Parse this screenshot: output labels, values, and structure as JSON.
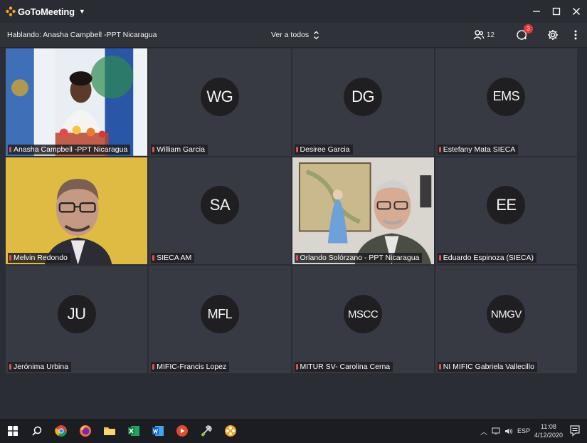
{
  "app": {
    "logo_text": "GoToMeeting"
  },
  "toolbar": {
    "speaking_text": "Hablando: Anasha Campbell -PPT Nicaragua",
    "view_label": "Ver a todos",
    "attendee_count": "12",
    "chat_badge": "3"
  },
  "tiles": [
    {
      "name": "Anasha Campbell -PPT Nicaragua",
      "initials": ""
    },
    {
      "name": "William Garcia",
      "initials": "WG"
    },
    {
      "name": "Desiree Garcia",
      "initials": "DG"
    },
    {
      "name": "Estefany Mata SIECA",
      "initials": "EMS"
    },
    {
      "name": "Melvin Redondo",
      "initials": ""
    },
    {
      "name": "SIECA AM",
      "initials": "SA"
    },
    {
      "name": "Orlando Solórzano - PPT Nicaragua",
      "initials": ""
    },
    {
      "name": "Eduardo Espinoza (SIECA)",
      "initials": "EE"
    },
    {
      "name": "Jerónima Urbina",
      "initials": "JU"
    },
    {
      "name": "MIFIC-Francis Lopez",
      "initials": "MFL"
    },
    {
      "name": "MITUR SV- Carolina Cerna",
      "initials": "MSCC"
    },
    {
      "name": "NI MIFIC Gabriela Vallecillo",
      "initials": "NMGV"
    }
  ],
  "taskbar": {
    "language": "ESP",
    "time": "11:08",
    "date": "4/12/2020"
  },
  "colors": {
    "background": "#2b2d35",
    "tile": "#383a43",
    "avatar": "#1f1f22",
    "accent": "#f5a623",
    "badge": "#e53935"
  }
}
